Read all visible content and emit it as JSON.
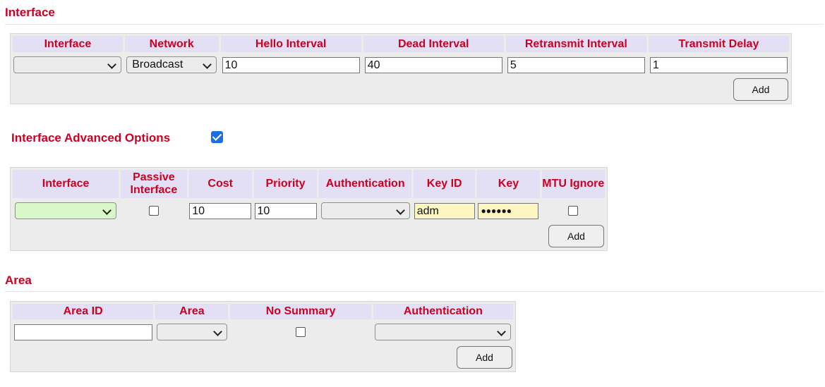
{
  "interface_section": {
    "title": "Interface",
    "headers": [
      "Interface",
      "Network",
      "Hello Interval",
      "Dead Interval",
      "Retransmit Interval",
      "Transmit Delay"
    ],
    "interface_value": "",
    "network_value": "Broadcast",
    "hello_interval": "10",
    "dead_interval": "40",
    "retransmit_interval": "5",
    "transmit_delay": "1",
    "add_label": "Add"
  },
  "advanced": {
    "title": "Interface Advanced Options",
    "enabled": true,
    "headers": [
      "Interface",
      "Passive Interface",
      "Cost",
      "Priority",
      "Authentication",
      "Key ID",
      "Key",
      "MTU Ignore"
    ],
    "passive_header_line1": "Passive",
    "passive_header_line2": "Interface",
    "interface_value": "",
    "passive_checked": false,
    "cost": "10",
    "priority": "10",
    "authentication_value": "",
    "key_id": "adm",
    "key_masked": "●●●●●●",
    "mtu_ignore_checked": false,
    "add_label": "Add"
  },
  "area": {
    "title": "Area",
    "headers": [
      "Area ID",
      "Area",
      "No Summary",
      "Authentication"
    ],
    "area_id": "",
    "area_value": "",
    "no_summary_checked": false,
    "authentication_value": "",
    "add_label": "Add"
  },
  "colors": {
    "title_red": "#cc0022",
    "header_bg": "#e3e0f6",
    "table_bg": "#ececec",
    "checkbox_blue": "#1a6ee6",
    "autofill_green": "#d9f7c8",
    "autofill_yellow": "#fdf6c3"
  }
}
